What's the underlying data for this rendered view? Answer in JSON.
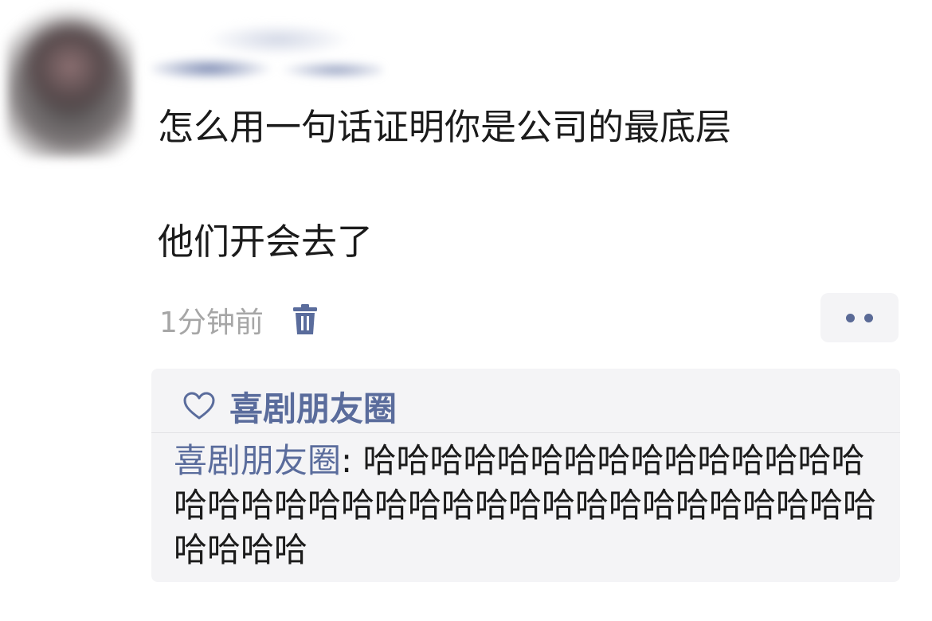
{
  "post": {
    "line1": "怎么用一句话证明你是公司的最底层",
    "line2": "他们开会去了",
    "time": "1分钟前"
  },
  "likes": {
    "names": "喜剧朋友圈"
  },
  "comment": {
    "author": "喜剧朋友圈",
    "separator": ": ",
    "text": "哈哈哈哈哈哈哈哈哈哈哈哈哈哈哈哈哈哈哈哈哈哈哈哈哈哈哈哈哈哈哈哈哈哈哈哈哈哈哈哈"
  },
  "colors": {
    "accent": "#5a6c9c",
    "time": "#a6a6a6",
    "comment_bg": "#f4f4f6"
  },
  "icons": {
    "delete": "trash-icon",
    "like": "heart-icon",
    "more": "more-dots-icon"
  }
}
